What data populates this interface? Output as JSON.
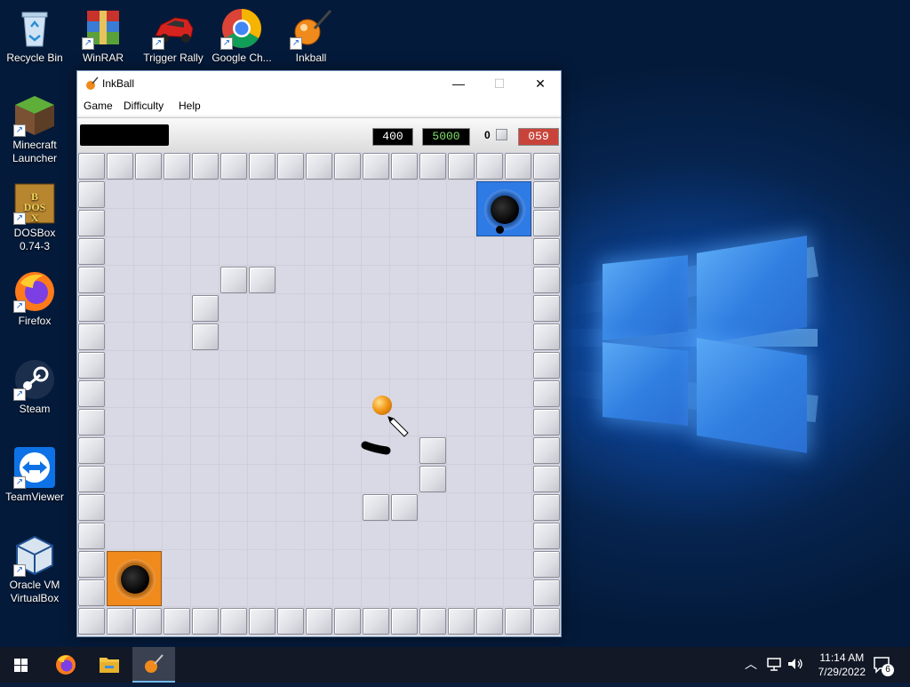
{
  "desktop": {
    "icons": [
      {
        "label": "Recycle Bin",
        "icon": "recycle-bin-icon"
      },
      {
        "label": "WinRAR",
        "icon": "winrar-icon"
      },
      {
        "label": "Trigger Rally",
        "icon": "car-icon"
      },
      {
        "label": "Google Ch...",
        "icon": "chrome-icon"
      },
      {
        "label": "Inkball",
        "icon": "inkball-icon"
      },
      {
        "label": "Minecraft Launcher",
        "icon": "minecraft-icon"
      },
      {
        "label": "DOSBox 0.74-3",
        "icon": "dosbox-icon"
      },
      {
        "label": "Firefox",
        "icon": "firefox-icon"
      },
      {
        "label": "Steam",
        "icon": "steam-icon"
      },
      {
        "label": "TeamViewer",
        "icon": "teamviewer-icon"
      },
      {
        "label": "Oracle VM VirtualBox",
        "icon": "virtualbox-icon"
      }
    ]
  },
  "window": {
    "title": "InkBall",
    "menus": [
      "Game",
      "Difficulty",
      "Help"
    ],
    "status": {
      "score": "400",
      "target": "5000",
      "walls_count": "0",
      "timer": "059"
    }
  },
  "taskbar": {
    "time": "11:14 AM",
    "date": "7/29/2022",
    "notifications": "6"
  },
  "colors": {
    "blue_hole": "#2f7be6",
    "orange_hole": "#f08a1c",
    "ball_orange": "#f29a1a",
    "timer_bg": "#c8443a",
    "target_text": "#7ee06a"
  }
}
